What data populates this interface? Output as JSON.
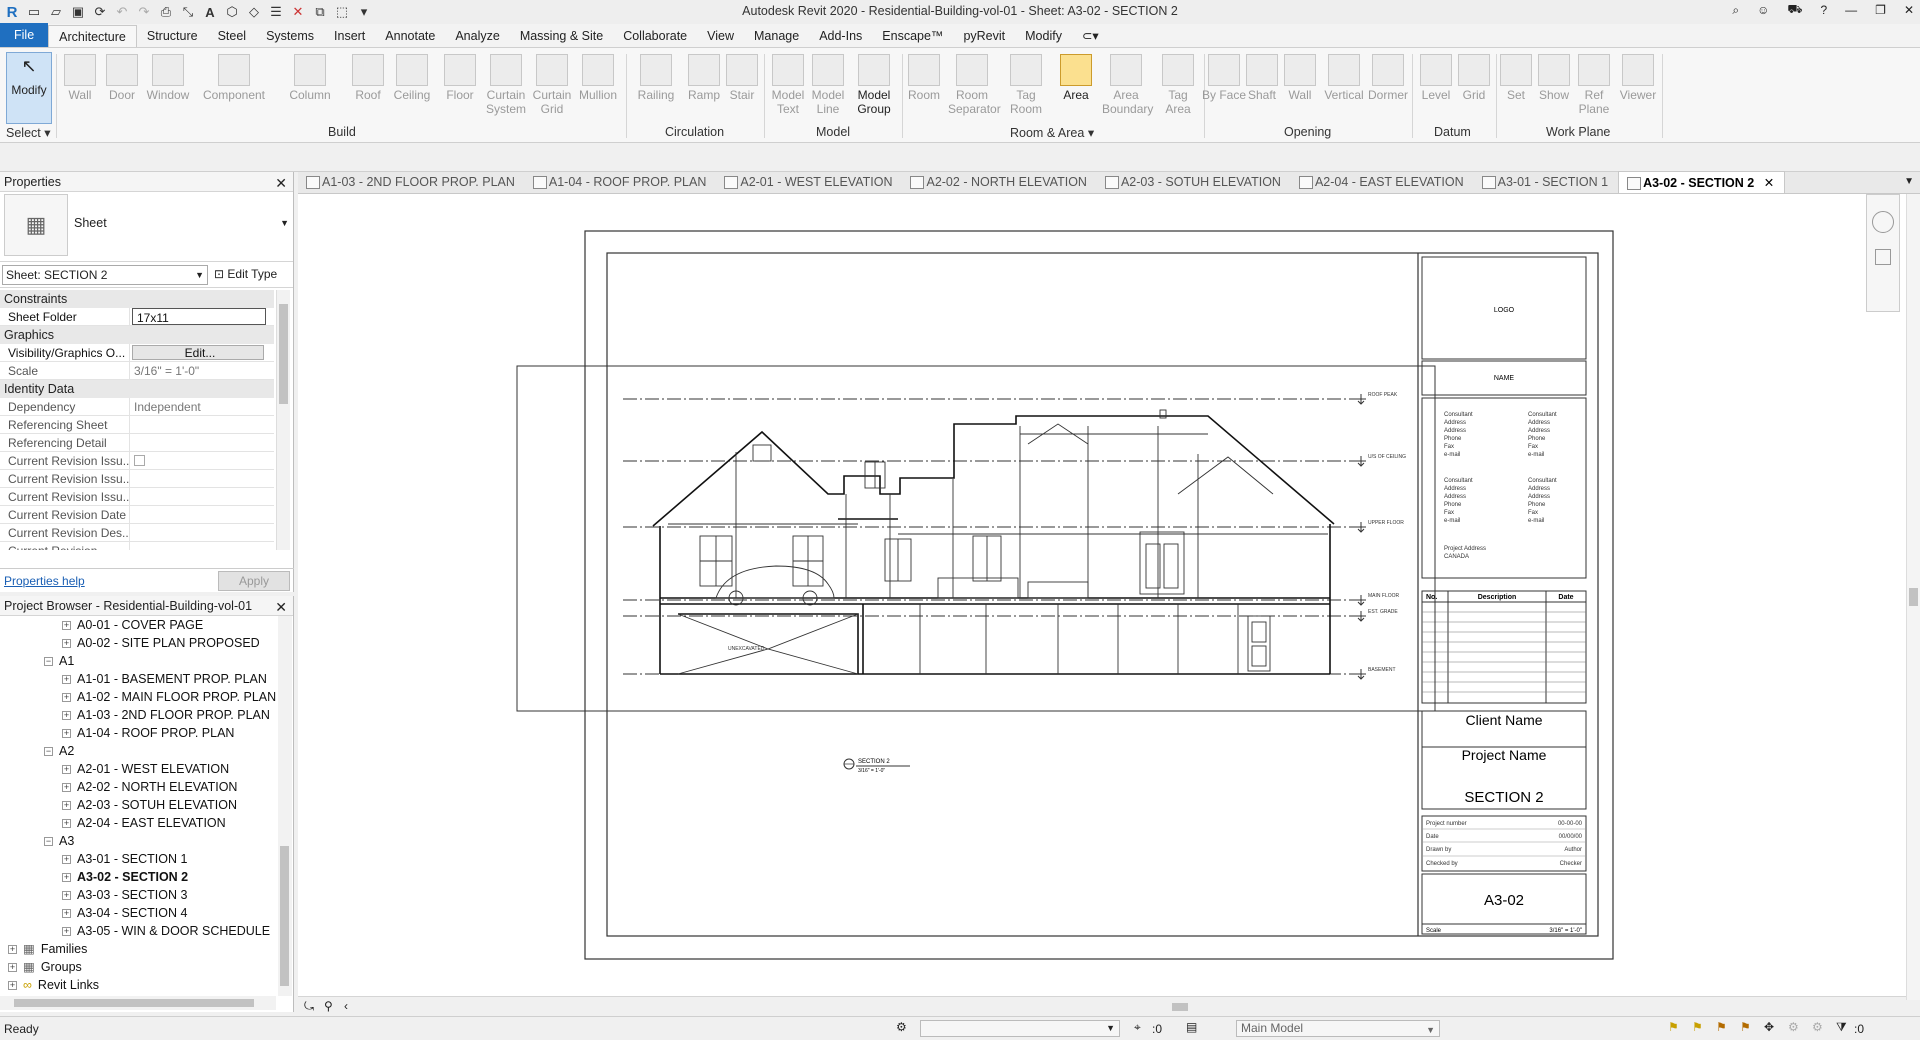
{
  "title_bar": {
    "title": "Autodesk Revit 2020 - Residential-Building-vol-01 - Sheet: A3-02 - SECTION 2"
  },
  "ribbon_tabs": [
    "File",
    "Architecture",
    "Structure",
    "Steel",
    "Systems",
    "Insert",
    "Annotate",
    "Analyze",
    "Massing & Site",
    "Collaborate",
    "View",
    "Manage",
    "Add-Ins",
    "Enscape™",
    "pyRevit",
    "Modify"
  ],
  "ribbon": {
    "modify": "Modify",
    "select": "Select",
    "build": [
      "Wall",
      "Door",
      "Window",
      "Component",
      "Column",
      "Roof",
      "Ceiling",
      "Floor",
      "Curtain System",
      "Curtain Grid",
      "Mullion"
    ],
    "circulation": [
      "Railing",
      "Ramp",
      "Stair"
    ],
    "model": [
      "Model Text",
      "Model Line",
      "Model Group"
    ],
    "room_area": [
      "Room",
      "Room Separator",
      "Tag Room",
      "Area",
      "Area Boundary",
      "Tag Area"
    ],
    "opening": [
      "By Face",
      "Shaft",
      "Wall",
      "Vertical",
      "Dormer"
    ],
    "datum": [
      "Level",
      "Grid"
    ],
    "workplane": [
      "Set",
      "Show",
      "Ref Plane",
      "Viewer"
    ],
    "panels": [
      "Build",
      "Circulation",
      "Model",
      "Room & Area",
      "Opening",
      "Datum",
      "Work Plane"
    ]
  },
  "doc_tabs": [
    "A1-03 - 2ND FLOOR PROP. PLAN",
    "A1-04 - ROOF PROP. PLAN",
    "A2-01 - WEST ELEVATION",
    "A2-02 - NORTH ELEVATION",
    "A2-03 - SOTUH ELEVATION",
    "A2-04 - EAST ELEVATION",
    "A3-01 - SECTION 1",
    "A3-02 - SECTION 2"
  ],
  "properties": {
    "header": "Properties",
    "type_name": "Sheet",
    "selector": "Sheet: SECTION 2",
    "edit_type": "Edit Type",
    "sections": {
      "constraints": "Constraints",
      "graphics": "Graphics",
      "identity": "Identity Data"
    },
    "rows": {
      "sheet_folder": [
        "Sheet Folder",
        "17x11"
      ],
      "visibility": [
        "Visibility/Graphics O...",
        "Edit..."
      ],
      "scale": [
        "Scale",
        "3/16\" = 1'-0\""
      ],
      "dependency": [
        "Dependency",
        "Independent"
      ],
      "ref_sheet": [
        "Referencing Sheet",
        ""
      ],
      "ref_detail": [
        "Referencing Detail",
        ""
      ],
      "rev1": [
        "Current Revision Issu...",
        ""
      ],
      "rev2": [
        "Current Revision Issu...",
        ""
      ],
      "rev3": [
        "Current Revision Issu...",
        ""
      ],
      "rev_date": [
        "Current Revision Date",
        ""
      ],
      "rev_des": [
        "Current Revision Des...",
        ""
      ],
      "rev": [
        "Current Revision",
        ""
      ]
    },
    "help": "Properties help",
    "apply": "Apply"
  },
  "browser": {
    "header": "Project Browser - Residential-Building-vol-01",
    "items": [
      {
        "t": "A0-01 - COVER PAGE",
        "lvl": 2
      },
      {
        "t": "A0-02 - SITE PLAN PROPOSED",
        "lvl": 2
      },
      {
        "t": "A1",
        "lvl": 1
      },
      {
        "t": "A1-01 - BASEMENT PROP. PLAN",
        "lvl": 2
      },
      {
        "t": "A1-02 - MAIN FLOOR PROP. PLAN",
        "lvl": 2
      },
      {
        "t": "A1-03 - 2ND FLOOR PROP. PLAN",
        "lvl": 2
      },
      {
        "t": "A1-04 - ROOF PROP. PLAN",
        "lvl": 2
      },
      {
        "t": "A2",
        "lvl": 1
      },
      {
        "t": "A2-01 - WEST ELEVATION",
        "lvl": 2
      },
      {
        "t": "A2-02 - NORTH ELEVATION",
        "lvl": 2
      },
      {
        "t": "A2-03 - SOTUH ELEVATION",
        "lvl": 2
      },
      {
        "t": "A2-04 - EAST ELEVATION",
        "lvl": 2
      },
      {
        "t": "A3",
        "lvl": 1
      },
      {
        "t": "A3-01 - SECTION 1",
        "lvl": 2
      },
      {
        "t": "A3-02 - SECTION 2",
        "lvl": 2,
        "bold": true
      },
      {
        "t": "A3-03 - SECTION 3",
        "lvl": 2
      },
      {
        "t": "A3-04 - SECTION 4",
        "lvl": 2
      },
      {
        "t": "A3-05 - WIN & DOOR SCHEDULE",
        "lvl": 2
      },
      {
        "t": "Families",
        "lvl": 0
      },
      {
        "t": "Groups",
        "lvl": 0
      },
      {
        "t": "Revit Links",
        "lvl": 0
      }
    ]
  },
  "sheet": {
    "logo": "LOGO",
    "name": "NAME",
    "consultant_block": [
      "Consultant",
      "Address",
      "Address",
      "Phone",
      "Fax",
      "e-mail"
    ],
    "project_address": [
      "Project Address",
      "CANADA"
    ],
    "rev_headers": [
      "No.",
      "Description",
      "Date"
    ],
    "client": "Client Name",
    "project": "Project Name",
    "sheet_name": "SECTION 2",
    "info": [
      [
        "Project number",
        "00-00-00"
      ],
      [
        "Date",
        "00/00/00"
      ],
      [
        "Drawn by",
        "Author"
      ],
      [
        "Checked by",
        "Checker"
      ]
    ],
    "sheet_number": "A3-02",
    "scale_row": [
      "Scale",
      "3/16\" = 1'-0\""
    ],
    "view_title": "SECTION 2",
    "view_scale": "3/16\" = 1'-0\"",
    "levels": [
      "ROOF PEAK",
      "U/S OF CEILING",
      "UPPER FLOOR",
      "MAIN FLOOR",
      "EST. GRADE",
      "BASEMENT"
    ],
    "unexcavated": "UNEXCAVATED"
  },
  "status": {
    "ready": "Ready",
    "zero1": ":0",
    "main_model": "Main Model",
    "zero2": ":0"
  }
}
